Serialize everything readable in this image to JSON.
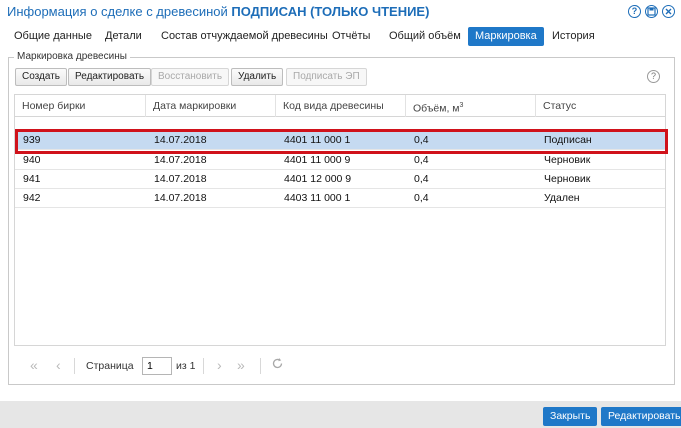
{
  "window": {
    "title_prefix": "Информация о сделке с древесиной ",
    "title_status": "ПОДПИСАН",
    "title_mode": "(ТОЛЬКО ЧТЕНИЕ)",
    "icons": [
      "help-icon",
      "save-icon",
      "close-icon"
    ],
    "accent_color": "#1f78c8"
  },
  "tabs": [
    {
      "label": "Общие данные",
      "active": false
    },
    {
      "label": "Детали",
      "active": false
    },
    {
      "label": "Состав отчуждаемой древесины",
      "active": false
    },
    {
      "label": "Отчёты",
      "active": false
    },
    {
      "label": "Общий объём",
      "active": false
    },
    {
      "label": "Маркировка",
      "active": true
    },
    {
      "label": "История",
      "active": false
    }
  ],
  "panel": {
    "legend": "Маркировка древесины",
    "toolbar": {
      "create": "Создать",
      "edit": "Редактировать",
      "restore": "Восстановить",
      "delete": "Удалить",
      "sign": "Подписать ЭП"
    }
  },
  "grid": {
    "columns": [
      "Номер бирки",
      "Дата маркировки",
      "Код вида древесины",
      "Объём, м³",
      "Статус"
    ],
    "rows": [
      {
        "tag": "939",
        "date": "14.07.2018",
        "code": "4401 11 000 1",
        "volume": "0,4",
        "status": "Подписан",
        "selected": true
      },
      {
        "tag": "940",
        "date": "14.07.2018",
        "code": "4401 11 000 9",
        "volume": "0,4",
        "status": "Черновик",
        "selected": false
      },
      {
        "tag": "941",
        "date": "14.07.2018",
        "code": "4401 12 000 9",
        "volume": "0,4",
        "status": "Черновик",
        "selected": false
      },
      {
        "tag": "942",
        "date": "14.07.2018",
        "code": "4403 11 000 1",
        "volume": "0,4",
        "status": "Удален",
        "selected": false
      }
    ]
  },
  "pager": {
    "page_label": "Страница",
    "page_value": "1",
    "of_label": "из 1"
  },
  "footer": {
    "close": "Закрыть",
    "edit": "Редактировать"
  }
}
